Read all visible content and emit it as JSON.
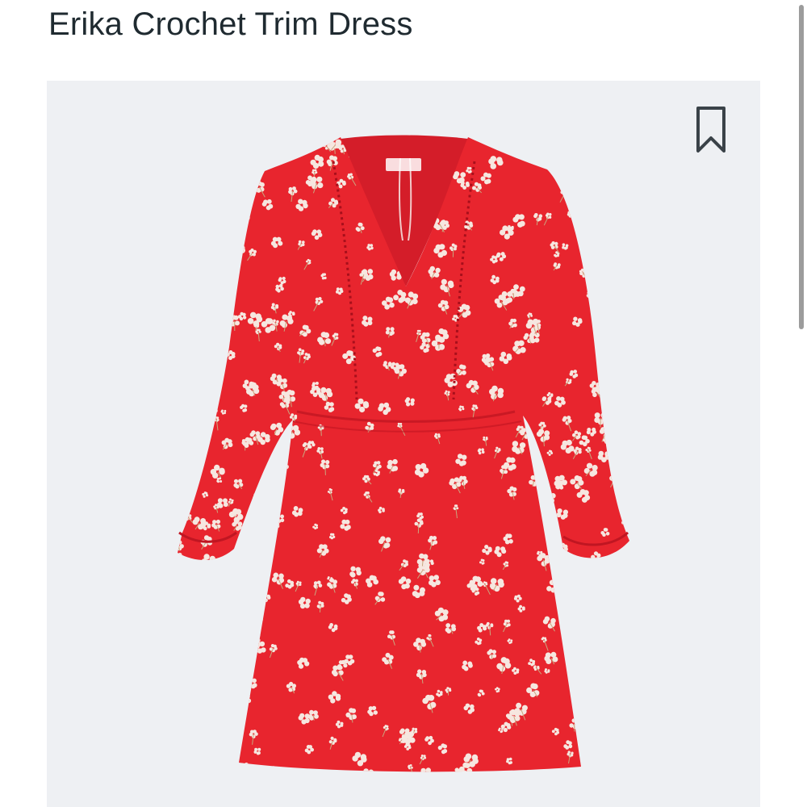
{
  "product": {
    "title": "Erika Crochet Trim Dress",
    "image": {
      "subject": "dress-photo",
      "background_color": "#eef0f3",
      "dress_color": "#e8252e",
      "print_color": "#f6e7e0"
    },
    "bookmark_icon": "bookmark-icon"
  },
  "colors": {
    "title_text": "#1f2a30",
    "icon_stroke": "#3a4248",
    "scrollbar": "#9c9c9c"
  }
}
